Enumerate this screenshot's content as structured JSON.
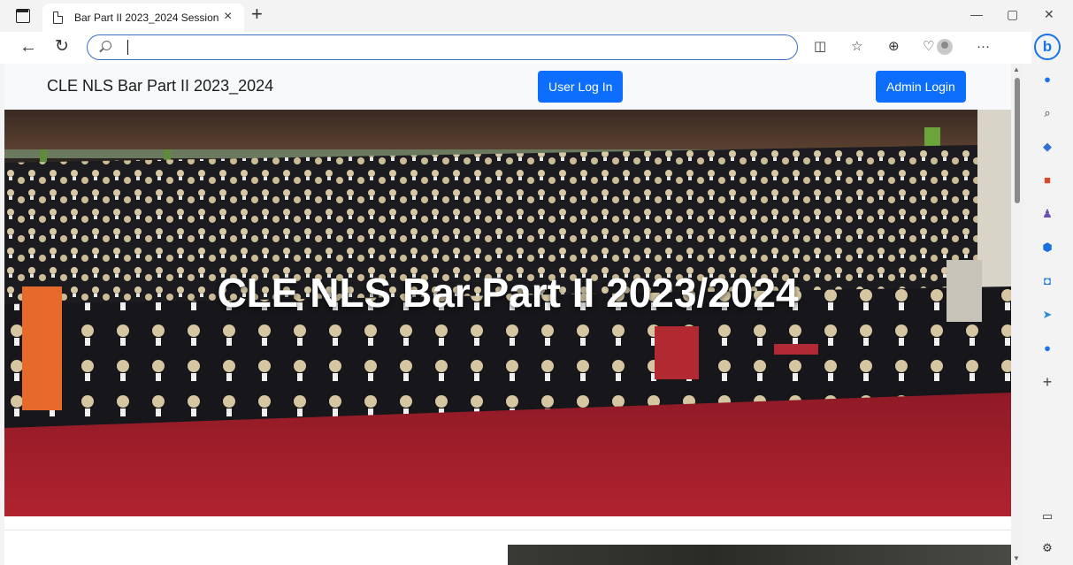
{
  "browser": {
    "tab_title": "Bar Part II 2023_2024 Session",
    "tab_close": "×",
    "new_tab": "+",
    "address_value": "",
    "window_controls": {
      "minimize": "—",
      "restore": "▢",
      "close": "✕"
    },
    "nav": {
      "back": "←",
      "refresh": "↻"
    },
    "toolbar_icons": [
      "reading-view-icon",
      "favorites-icon",
      "collections-icon",
      "browser-essentials-icon",
      "profile-icon",
      "more-icon"
    ],
    "more_label": "···"
  },
  "sidebar": {
    "bing_label": "b",
    "items": [
      "bell-icon",
      "search-icon",
      "tag-icon",
      "toolbox-icon",
      "games-icon",
      "office-icon",
      "outlook-icon",
      "send-icon",
      "google-icon",
      "add-icon"
    ],
    "add_label": "+"
  },
  "site": {
    "brand": "CLE NLS Bar Part II 2023_2024",
    "user_login": "User Log In",
    "admin_login": "Admin Login",
    "hero_title": "CLE NLS Bar Part II 2023/2024"
  },
  "colors": {
    "primary": "#0d6efd",
    "carpet": "#a01e2c",
    "robe": "#1b1b1f",
    "wig": "#d8c9a4"
  }
}
